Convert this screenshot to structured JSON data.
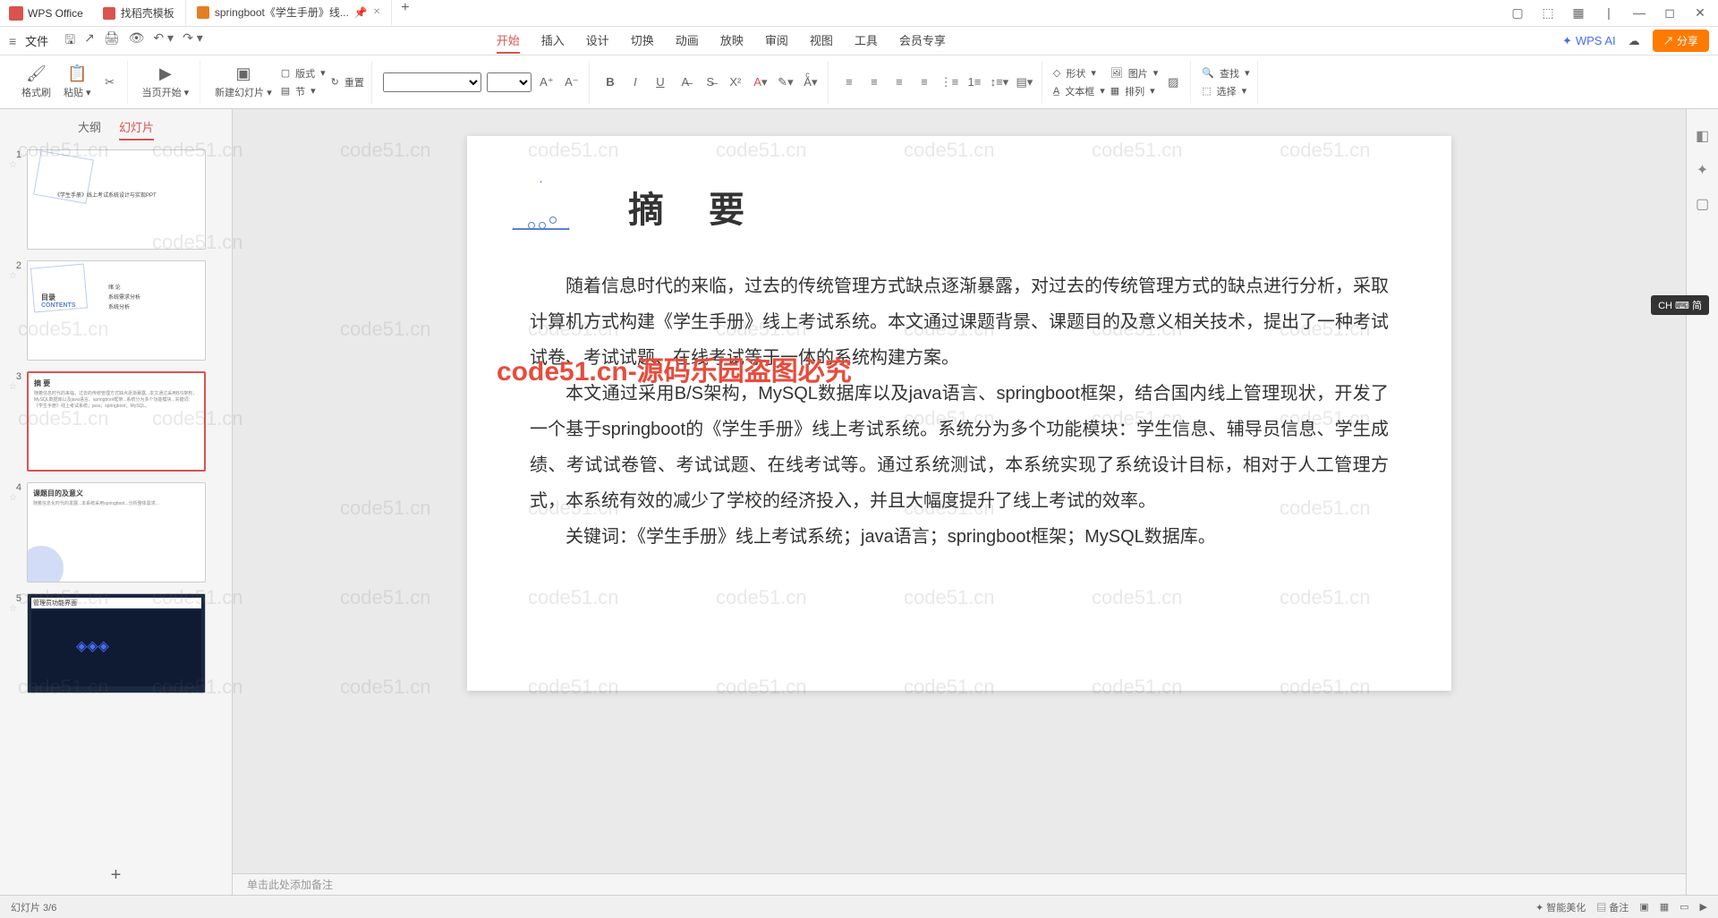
{
  "app": {
    "name": "WPS Office"
  },
  "tabs": [
    {
      "label": "找稻壳模板",
      "icon": "red"
    },
    {
      "label": "springboot《学生手册》线...",
      "icon": "orange",
      "active": true
    }
  ],
  "file_menu": "文件",
  "ribbon_tabs": [
    "开始",
    "插入",
    "设计",
    "切换",
    "动画",
    "放映",
    "审阅",
    "视图",
    "工具",
    "会员专享"
  ],
  "ribbon_active": 0,
  "wps_ai": "WPS AI",
  "share": "分享",
  "toolbar": {
    "format_painter": "格式刷",
    "paste": "粘贴",
    "play": "当页开始",
    "new_slide": "新建幻灯片",
    "layout": "版式",
    "section": "节",
    "reset": "重置",
    "shape": "形状",
    "image": "图片",
    "textbox": "文本框",
    "arrange": "排列",
    "find": "查找",
    "select": "选择"
  },
  "panel": {
    "outline": "大纲",
    "slides": "幻灯片"
  },
  "thumbs": [
    {
      "n": "1",
      "title": "《学生手册》线上考试系统设计与实现PPT"
    },
    {
      "n": "2",
      "title": "目录",
      "sub": "CONTENTS",
      "items": [
        "绪 论",
        "系统需求分析",
        "系统分析"
      ]
    },
    {
      "n": "3",
      "title": "摘  要",
      "selected": true
    },
    {
      "n": "4",
      "title": "课题目的及意义"
    },
    {
      "n": "5",
      "title": "管理员功能界面"
    }
  ],
  "slide": {
    "heading": "摘  要",
    "p1": "随着信息时代的来临，过去的传统管理方式缺点逐渐暴露，对过去的传统管理方式的缺点进行分析，采取计算机方式构建《学生手册》线上考试系统。本文通过课题背景、课题目的及意义相关技术，提出了一种考试试卷、考试试题、在线考试等于一体的系统构建方案。",
    "p2": "本文通过采用B/S架构，MySQL数据库以及java语言、springboot框架，结合国内线上管理现状，开发了一个基于springboot的《学生手册》线上考试系统。系统分为多个功能模块：学生信息、辅导员信息、学生成绩、考试试卷管、考试试题、在线考试等。通过系统测试，本系统实现了系统设计目标，相对于人工管理方式，本系统有效的减少了学校的经济投入，并且大幅度提升了线上考试的效率。",
    "p3": "关键词：《学生手册》线上考试系统；java语言；springboot框架；MySQL数据库。"
  },
  "notes_placeholder": "单击此处添加备注",
  "status": {
    "left": "幻灯片 3/6",
    "smart": "智能美化"
  },
  "ime": "CH ⌨ 简",
  "watermark_text": "code51.cn",
  "watermark_red": "code51.cn-源码乐园盗图必究"
}
